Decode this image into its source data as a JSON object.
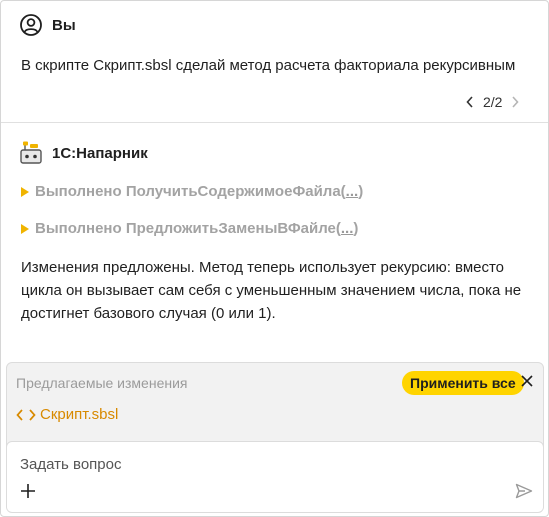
{
  "user": {
    "name": "Вы",
    "message": "В скрипте Скрипт.sbsl сделай метод расчета факториала рекурсивным",
    "pager": "2/2"
  },
  "assistant": {
    "name": "1С:Напарник",
    "actions": [
      {
        "label": "Выполнено ПолучитьСодержимоеФайла(",
        "dots": "...",
        "close": ")"
      },
      {
        "label": "Выполнено ПредложитьЗаменыВФайле(",
        "dots": "...",
        "close": ")"
      }
    ],
    "message": "Изменения предложены. Метод теперь использует рекурсию: вместо цикла он вызывает сам себя с уменьшенным значением числа, пока не достигнет базового случая (0 или 1)."
  },
  "changes": {
    "title": "Предлагаемые изменения",
    "apply_label": "Применить все",
    "file": "Скрипт.sbsl"
  },
  "input": {
    "placeholder": "Задать вопрос"
  },
  "colors": {
    "accent": "#ffd400",
    "file_link": "#d88a00",
    "triangle": "#f0b400"
  },
  "icons": {
    "user": "user-icon",
    "bot": "robot-icon",
    "prev": "chevron-left-icon",
    "next": "chevron-right-icon",
    "close": "close-icon",
    "code": "code-icon",
    "plus": "plus-icon",
    "send": "send-icon"
  }
}
